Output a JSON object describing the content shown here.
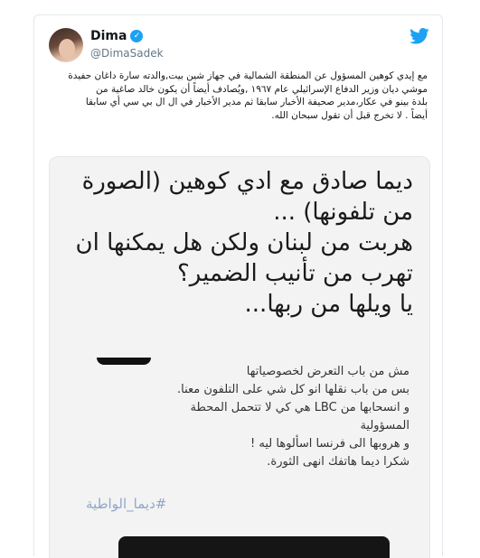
{
  "tweet": {
    "display_name": "Dima",
    "handle": "@DimaSadek",
    "body_lines": [
      "مع إيدي كوهين المسؤول عن المنطقة الشمالية في جهاز شين بيت,والدته سارة داغان حفيدة",
      "موشي ديان وزير الدفاع الإسرائيلي عام ١٩٦٧ ,ويُصادف أيضاً أن يكون خالد صاغية من",
      "بلدة بينو في عكار،مدير صحيفة الأخبار سابقا ثم مدير الأخبار في ال ال بي سي أي سابقا",
      "أيضاً . لا تخرج قبل أن تقول سبحان الله."
    ]
  },
  "media": {
    "headline_lines": [
      "ديما صادق مع ادي كوهين (الصورة",
      "من تلفونها) ...",
      "هربت من لبنان ولكن هل يمكنها ان",
      "تهرب من تأنيب الضمير؟",
      "يا ويلها من ربها..."
    ],
    "body_lines": [
      "مش من باب التعرض لخصوصياتها",
      "بس من باب نقلها انو كل شي على التلفون معنا.",
      "و انسحابها من LBC هي كي لا تتحمل المحطة",
      "المسؤولية",
      "و هروبها الى فرنسا اسألوها ليه !",
      "شكرا ديما هاتفك انهى الثورة."
    ],
    "hashtag": "#ديما_الواطية"
  },
  "colors": {
    "twitter_blue": "#1da1f2",
    "hashtag": "#8fa8c8"
  },
  "icons": {
    "brand": "twitter-bird-icon",
    "verified": "verified-badge-icon"
  }
}
